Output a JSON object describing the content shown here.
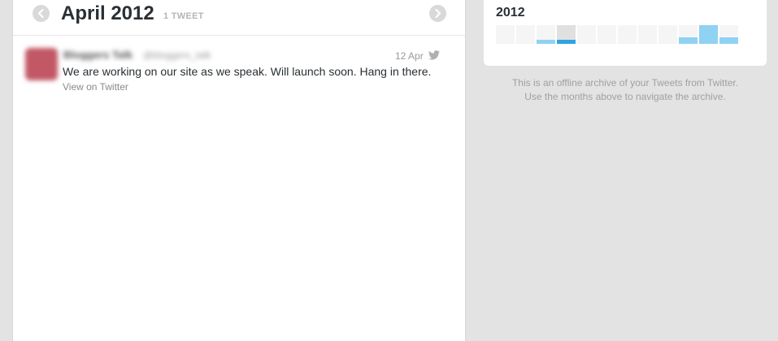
{
  "header": {
    "title": "April 2012",
    "tweet_count": "1 TWEET",
    "prev_icon": "chevron-left-icon",
    "next_icon": "chevron-right-icon"
  },
  "tweet": {
    "user_name": "Bloggers Talk",
    "user_handle": "@bloggers_talk",
    "date": "12 Apr",
    "text": "We are working on our site as we speak. Will launch soon. Hang in there.",
    "view_link": "View on Twitter",
    "source_icon": "twitter-bird-icon"
  },
  "sidebar": {
    "year": "2012",
    "months": [
      {
        "level": 0,
        "current": false
      },
      {
        "level": 0,
        "current": false
      },
      {
        "level": 0.2,
        "current": false
      },
      {
        "level": 0.2,
        "current": true
      },
      {
        "level": 0,
        "current": false
      },
      {
        "level": 0,
        "current": false
      },
      {
        "level": 0,
        "current": false
      },
      {
        "level": 0,
        "current": false
      },
      {
        "level": 0,
        "current": false
      },
      {
        "level": 0.35,
        "current": false
      },
      {
        "level": 1,
        "current": false
      },
      {
        "level": 0.35,
        "current": false
      }
    ],
    "note_line1": "This is an offline archive of your Tweets from Twitter.",
    "note_line2": "Use the months above to navigate the archive."
  },
  "colors": {
    "accent": "#2ea3e0",
    "accent_light": "#8fd2f2",
    "text": "#292f33"
  }
}
